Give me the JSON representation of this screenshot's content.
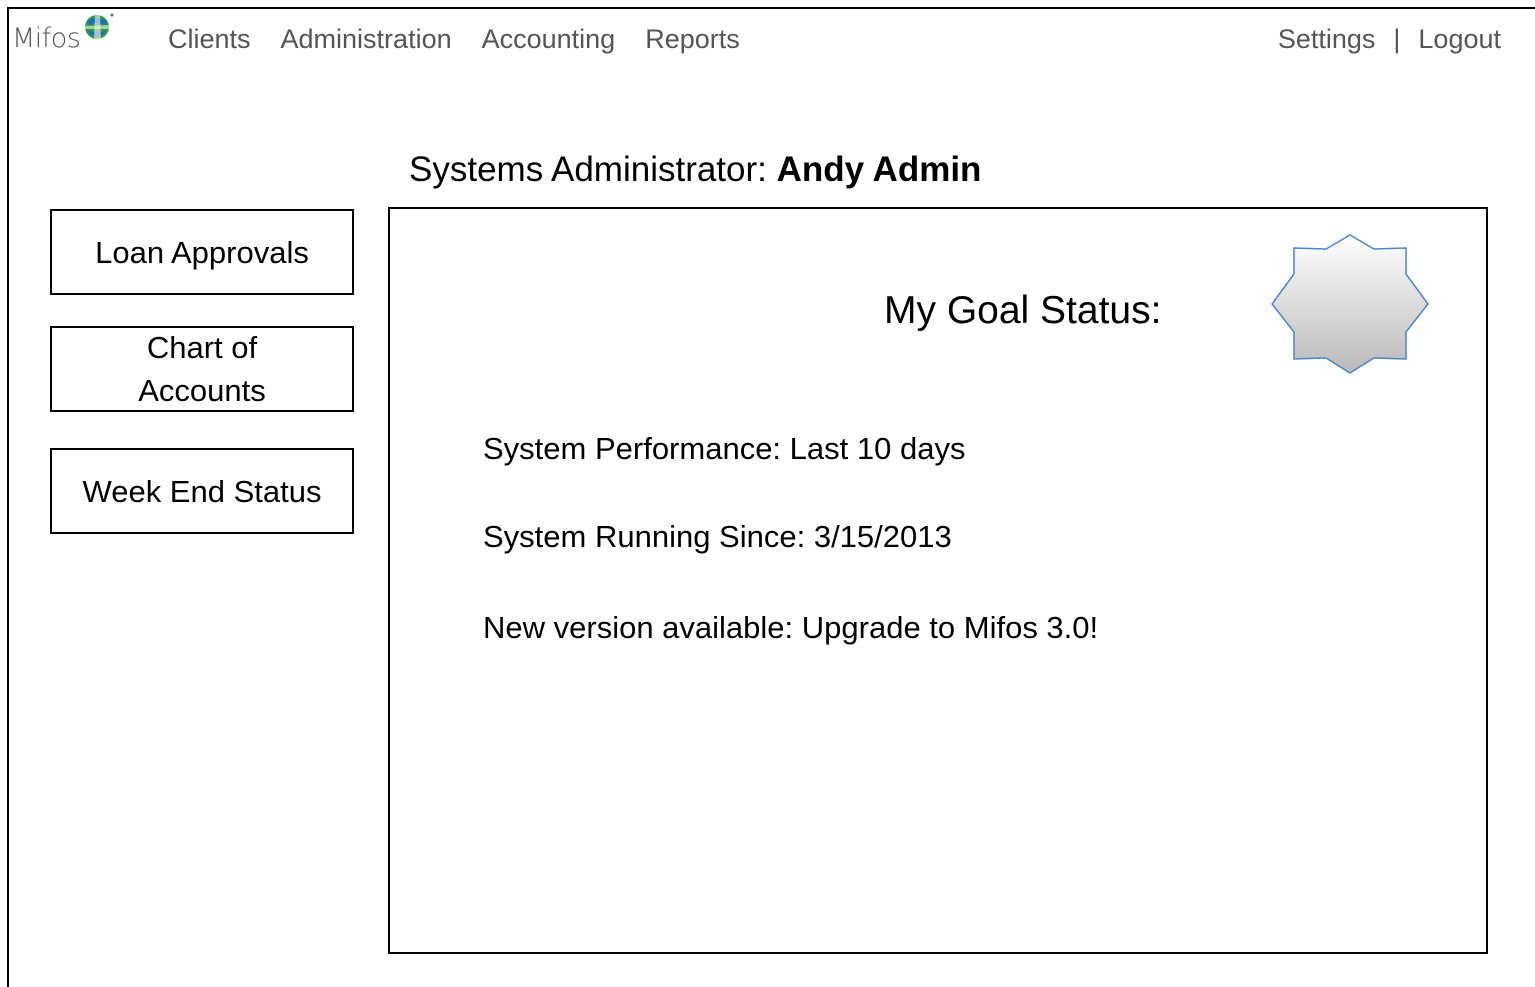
{
  "header": {
    "logo_text": "Mifos",
    "nav": [
      "Clients",
      "Administration",
      "Accounting",
      "Reports"
    ],
    "settings_label": "Settings",
    "separator": "|",
    "logout_label": "Logout"
  },
  "page": {
    "role_label": "Systems Administrator:",
    "user_name": "Andy Admin"
  },
  "sidebar": {
    "items": [
      {
        "label": "Loan Approvals"
      },
      {
        "label": "Chart of Accounts"
      },
      {
        "label": "Week End Status"
      }
    ]
  },
  "main": {
    "goal_label": "My Goal Status:",
    "lines": [
      "System Performance: Last 10 days",
      "System Running Since: 3/15/2013",
      "New version available: Upgrade to Mifos 3.0!"
    ]
  },
  "colors": {
    "nav_text": "#555555",
    "badge_stroke": "#4a86c6",
    "badge_fill_top": "#ffffff",
    "badge_fill_bottom": "#b9b9b9"
  }
}
